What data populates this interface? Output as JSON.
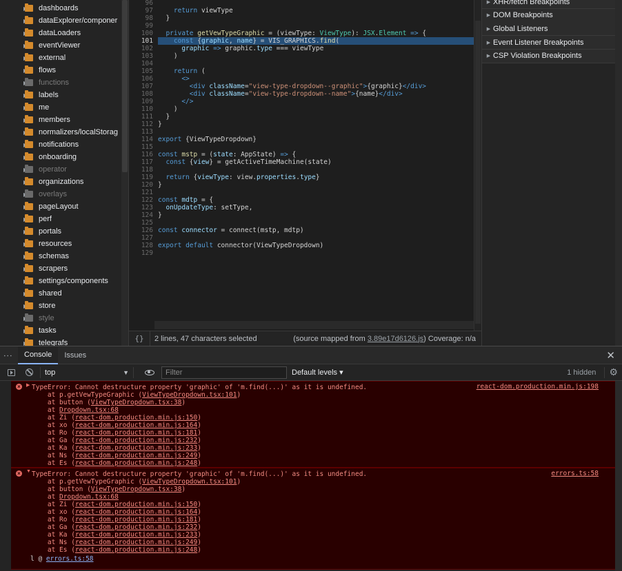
{
  "file_tree": {
    "items": [
      {
        "label": "dashboards",
        "dim": false
      },
      {
        "label": "dataExplorer/componer",
        "dim": false
      },
      {
        "label": "dataLoaders",
        "dim": false
      },
      {
        "label": "eventViewer",
        "dim": false
      },
      {
        "label": "external",
        "dim": false
      },
      {
        "label": "flows",
        "dim": false
      },
      {
        "label": "functions",
        "dim": true
      },
      {
        "label": "labels",
        "dim": false
      },
      {
        "label": "me",
        "dim": false
      },
      {
        "label": "members",
        "dim": false
      },
      {
        "label": "normalizers/localStorag",
        "dim": false
      },
      {
        "label": "notifications",
        "dim": false
      },
      {
        "label": "onboarding",
        "dim": false
      },
      {
        "label": "operator",
        "dim": true
      },
      {
        "label": "organizations",
        "dim": false
      },
      {
        "label": "overlays",
        "dim": true
      },
      {
        "label": "pageLayout",
        "dim": false
      },
      {
        "label": "perf",
        "dim": false
      },
      {
        "label": "portals",
        "dim": false
      },
      {
        "label": "resources",
        "dim": false
      },
      {
        "label": "schemas",
        "dim": false
      },
      {
        "label": "scrapers",
        "dim": false
      },
      {
        "label": "settings/components",
        "dim": false
      },
      {
        "label": "shared",
        "dim": false
      },
      {
        "label": "store",
        "dim": false
      },
      {
        "label": "style",
        "dim": true
      },
      {
        "label": "tasks",
        "dim": false
      },
      {
        "label": "telegrafs",
        "dim": false
      }
    ]
  },
  "editor": {
    "lines": [
      {
        "n": "96",
        "html": ""
      },
      {
        "n": "97",
        "html": "    <span class=\"kw\">return</span> viewType"
      },
      {
        "n": "98",
        "html": "  }"
      },
      {
        "n": "99",
        "html": ""
      },
      {
        "n": "100",
        "html": "  <span class=\"kw\">private</span> <span class=\"fn\">getVewTypeGraphic</span> = (viewType: <span class=\"typ\">ViewType</span>): <span class=\"typ\">JSX</span>.<span class=\"typ\">Element</span> <span class=\"kw\">=&gt;</span> {"
      },
      {
        "n": "101",
        "html": "    <span class=\"kw\">const</span> {<span class=\"prop\">graphic</span>, <span class=\"prop\">name</span>} = VIS_GRAPHICS.<span class=\"fn\">find</span>("
      },
      {
        "n": "102",
        "html": "      <span class=\"prop\">graphic</span> <span class=\"kw\">=&gt;</span> graphic.<span class=\"prop\">type</span> === viewType"
      },
      {
        "n": "103",
        "html": "    )"
      },
      {
        "n": "104",
        "html": ""
      },
      {
        "n": "105",
        "html": "    <span class=\"kw\">return</span> ("
      },
      {
        "n": "106",
        "html": "      <span class=\"tag\">&lt;&gt;</span>"
      },
      {
        "n": "107",
        "html": "        <span class=\"tag\">&lt;div</span> <span class=\"attr\">className</span>=<span class=\"str\">\"view-type-dropdown--graphic\"</span><span class=\"tag\">&gt;</span>{graphic}<span class=\"tag\">&lt;/div&gt;</span>"
      },
      {
        "n": "108",
        "html": "        <span class=\"tag\">&lt;div</span> <span class=\"attr\">className</span>=<span class=\"str\">\"view-type-dropdown--name\"</span><span class=\"tag\">&gt;</span>{name}<span class=\"tag\">&lt;/div&gt;</span>"
      },
      {
        "n": "109",
        "html": "      <span class=\"tag\">&lt;/&gt;</span>"
      },
      {
        "n": "110",
        "html": "    )"
      },
      {
        "n": "111",
        "html": "  }"
      },
      {
        "n": "112",
        "html": "}"
      },
      {
        "n": "113",
        "html": ""
      },
      {
        "n": "114",
        "html": "<span class=\"kw\">export</span> {ViewTypeDropdown}"
      },
      {
        "n": "115",
        "html": ""
      },
      {
        "n": "116",
        "html": "<span class=\"kw\">const</span> <span class=\"fn\">mstp</span> = (<span class=\"prop\">state</span>: AppState) <span class=\"kw\">=&gt;</span> {"
      },
      {
        "n": "117",
        "html": "  <span class=\"kw\">const</span> {<span class=\"prop\">view</span>} = getActiveTimeMachine(state)"
      },
      {
        "n": "118",
        "html": ""
      },
      {
        "n": "119",
        "html": "  <span class=\"kw\">return</span> {<span class=\"prop\">viewType</span>: view.<span class=\"prop\">properties</span>.<span class=\"prop\">type</span>}"
      },
      {
        "n": "120",
        "html": "}"
      },
      {
        "n": "121",
        "html": ""
      },
      {
        "n": "122",
        "html": "<span class=\"kw\">const</span> <span class=\"prop\">mdtp</span> = {"
      },
      {
        "n": "123",
        "html": "  <span class=\"prop\">onUpdateType</span>: setType,"
      },
      {
        "n": "124",
        "html": "}"
      },
      {
        "n": "125",
        "html": ""
      },
      {
        "n": "126",
        "html": "<span class=\"kw\">const</span> <span class=\"prop\">connector</span> = connect(mstp, mdtp)"
      },
      {
        "n": "127",
        "html": ""
      },
      {
        "n": "128",
        "html": "<span class=\"kw\">export</span> <span class=\"kw\">default</span> connector(ViewTypeDropdown)"
      },
      {
        "n": "129",
        "html": ""
      }
    ],
    "status": {
      "format_icon": "{}",
      "selection": "2 lines, 47 characters selected",
      "source_mapped_prefix": "(source mapped from ",
      "source_mapped_link": "3.89e17d6126.js",
      "source_mapped_suffix": ") Coverage: n/a"
    }
  },
  "breakpoints": {
    "sections": [
      "XHR/fetch Breakpoints",
      "DOM Breakpoints",
      "Global Listeners",
      "Event Listener Breakpoints",
      "CSP Violation Breakpoints"
    ]
  },
  "console": {
    "tabs": [
      "Console",
      "Issues"
    ],
    "context": "top",
    "filter_placeholder": "Filter",
    "levels": "Default levels ▾",
    "hidden": "1 hidden",
    "messages": [
      {
        "source": "react-dom.production.min.js:198",
        "expanded": false,
        "lines": [
          "TypeError: Cannot destructure property 'graphic' of 'm.find(...)' as it is undefined.",
          "    at p.getVewTypeGraphic (<u>ViewTypeDropdown.tsx:101</u>)",
          "    at button (<u>ViewTypeDropdown.tsx:38</u>)",
          "    at <u>Dropdown.tsx:68</u>",
          "    at Zi (<u>react-dom.production.min.js:150</u>)",
          "    at xo (<u>react-dom.production.min.js:164</u>)",
          "    at Ro (<u>react-dom.production.min.js:181</u>)",
          "    at Ga (<u>react-dom.production.min.js:232</u>)",
          "    at Ka (<u>react-dom.production.min.js:233</u>)",
          "    at Ns (<u>react-dom.production.min.js:249</u>)",
          "    at Es (<u>react-dom.production.min.js:248</u>)"
        ]
      },
      {
        "source": "errors.ts:58",
        "expanded": true,
        "lines": [
          "TypeError: Cannot destructure property 'graphic' of 'm.find(...)' as it is undefined.",
          "    at p.getVewTypeGraphic (<u>ViewTypeDropdown.tsx:101</u>)",
          "    at button (<u>ViewTypeDropdown.tsx:38</u>)",
          "    at <u>Dropdown.tsx:68</u>",
          "    at Zi (<u>react-dom.production.min.js:150</u>)",
          "    at xo (<u>react-dom.production.min.js:164</u>)",
          "    at Ro (<u>react-dom.production.min.js:181</u>)",
          "    at Ga (<u>react-dom.production.min.js:232</u>)",
          "    at Ka (<u>react-dom.production.min.js:233</u>)",
          "    at Ns (<u>react-dom.production.min.js:249</u>)",
          "    at Es (<u>react-dom.production.min.js:248</u>)"
        ]
      }
    ],
    "stack_tail": {
      "prefix": "l @ ",
      "link": "errors.ts:58"
    }
  },
  "colors": {
    "error_text": "#f28b82",
    "error_bg": "#290000",
    "folder": "#d48a2c",
    "selection": "#264f78",
    "active_tab": "#8ab4f8"
  }
}
